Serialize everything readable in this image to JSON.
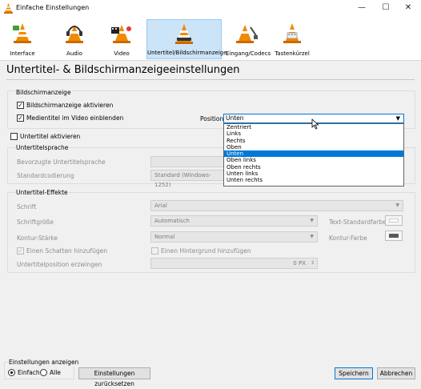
{
  "window": {
    "title": "Einfache Einstellungen",
    "controls": {
      "minimize": "—",
      "maximize": "☐",
      "close": "✕"
    }
  },
  "toolbar": {
    "items": [
      {
        "label": "Interface",
        "icon": "cone-interface-icon"
      },
      {
        "label": "Audio",
        "icon": "cone-headphones-icon"
      },
      {
        "label": "Video",
        "icon": "cone-film-icon"
      },
      {
        "label": "Untertitel/Bildschirmanzeige",
        "icon": "cone-subtitles-icon",
        "selected": true
      },
      {
        "label": "Eingang/Codecs",
        "icon": "cone-plug-icon"
      },
      {
        "label": "Tastenkürzel",
        "icon": "cone-keyboard-icon"
      }
    ]
  },
  "page": {
    "title": "Untertitel- & Bildschirmanzeigeeinstellungen"
  },
  "osd": {
    "group_label": "Bildschirmanzeige",
    "enable_label": "Bildschirmanzeige aktivieren",
    "enable_checked": true,
    "show_title_label": "Medientitel im Video einblenden",
    "show_title_checked": true,
    "position_label": "Position",
    "position_value": "Unten",
    "position_options": [
      "Zentriert",
      "Links",
      "Rechts",
      "Oben",
      "Unten",
      "Oben links",
      "Oben rechts",
      "Unten links",
      "Unten rechts"
    ],
    "highlighted_option": "Unten"
  },
  "subtitles": {
    "enable_label": "Untertitel aktivieren",
    "enable_checked": false,
    "language_group_label": "Untertitelsprache",
    "preferred_lang_label": "Bevorzugte Untertitelsprache",
    "encoding_label": "Standardcodierung",
    "encoding_value": "Standard (Windows-1252)"
  },
  "effects": {
    "group_label": "Untertitel-Effekte",
    "font_label": "Schrift",
    "font_value": "Arial",
    "font_size_label": "Schriftgröße",
    "font_size_value": "Automatisch",
    "text_color_label": "Text-Standardfarbe",
    "text_color": "#ffffff",
    "outline_label": "Kontur-Stärke",
    "outline_value": "Normal",
    "outline_color_label": "Kontur-Farbe",
    "outline_color": "#5a5a5a",
    "shadow_label": "Einen Schatten hinzufügen",
    "shadow_checked": true,
    "background_label": "Einen Hintergrund hinzufügen",
    "background_checked": false,
    "force_position_label": "Untertitelposition erzwingen",
    "force_position_value": "0 PX"
  },
  "footer": {
    "show_settings_label": "Einstellungen anzeigen",
    "simple_label": "Einfach",
    "all_label": "Alle",
    "selected_mode": "Einfach",
    "reset_label": "Einstellungen zurücksetzen",
    "save_label": "Speichern",
    "cancel_label": "Abbrechen"
  }
}
